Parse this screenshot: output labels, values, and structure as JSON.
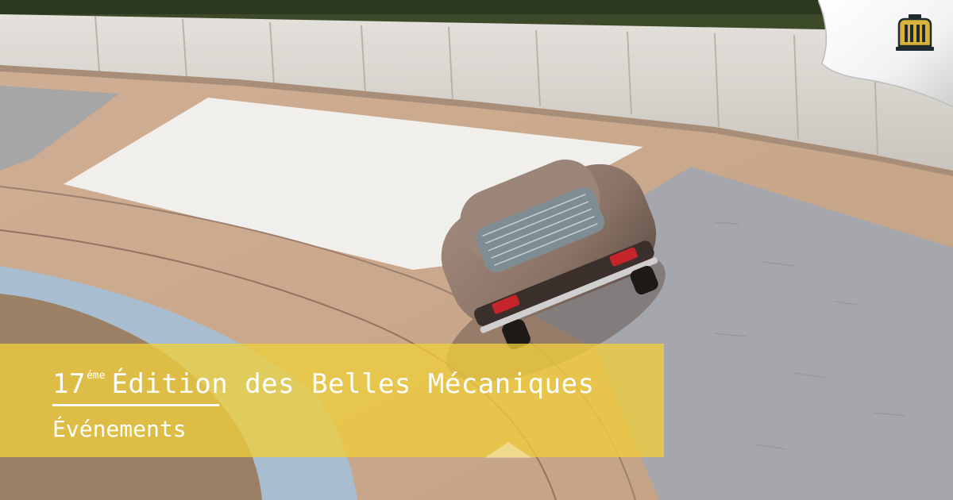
{
  "banner": {
    "title_number": "17",
    "title_suffix": "éme",
    "title_text": "Édition des Belles Mécaniques",
    "category": "Événements"
  },
  "colors": {
    "banner_yellow": "#f0ce3c",
    "text": "#ffffff",
    "logo_gold": "#d9b23a",
    "logo_dark": "#1f2a2e"
  },
  "icons": {
    "corner": "page-curl-icon",
    "logo": "building-columns-logo"
  }
}
